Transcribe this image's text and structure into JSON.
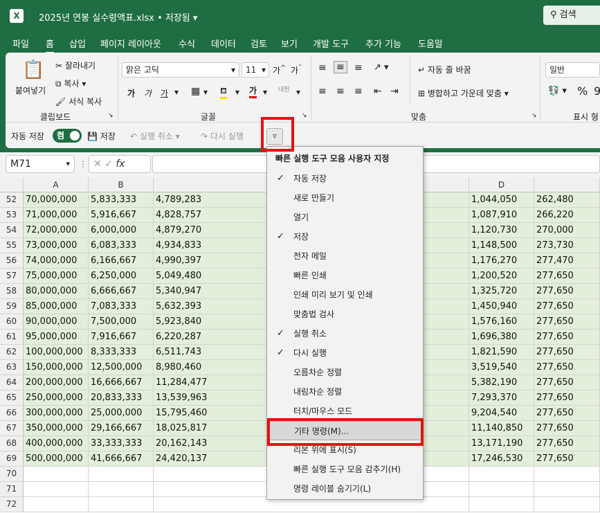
{
  "title_bar": {
    "app_icon": "X",
    "doc_title": "2025년 연봉 실수령액표.xlsx • 저장됨",
    "search": "검색"
  },
  "menu": [
    "파일",
    "홈",
    "삽입",
    "페이지 레이아웃",
    "수식",
    "데이터",
    "검토",
    "보기",
    "개발 도구",
    "추가 기능",
    "도움말"
  ],
  "ribbon": {
    "clipboard": {
      "paste": "붙여넣기",
      "cut": "잘라내기",
      "copy": "복사",
      "format_painter": "서식 복사",
      "group": "클립보드"
    },
    "font": {
      "name": "맑은 고딕",
      "size": "11",
      "bold": "가",
      "italic": "가",
      "underline": "가",
      "group": "글꼴"
    },
    "align": {
      "wrap": "자동 줄 바꿈",
      "merge": "병합하고 가운데 맞춤",
      "group": "맞춤"
    },
    "number": {
      "format": "일반",
      "group": "표시 형"
    }
  },
  "qat": {
    "autosave": "자동 저장",
    "toggle": "켬",
    "save": "저장",
    "undo": "실행 취소",
    "redo": "다시 실행"
  },
  "formula_bar": {
    "name_box": "M71",
    "fx": "fx"
  },
  "columns": [
    "A",
    "B",
    "",
    "D",
    ""
  ],
  "rows": [
    {
      "n": "52",
      "a": "70,000,000",
      "b": "5,833,333",
      "c": "4,789,283",
      "d": "1,044,050",
      "e": "262,480"
    },
    {
      "n": "53",
      "a": "71,000,000",
      "b": "5,916,667",
      "c": "4,828,757",
      "d": "1,087,910",
      "e": "266,220"
    },
    {
      "n": "54",
      "a": "72,000,000",
      "b": "6,000,000",
      "c": "4,879,270",
      "d": "1,120,730",
      "e": "270,000"
    },
    {
      "n": "55",
      "a": "73,000,000",
      "b": "6,083,333",
      "c": "4,934,833",
      "d": "1,148,500",
      "e": "273,730"
    },
    {
      "n": "56",
      "a": "74,000,000",
      "b": "6,166,667",
      "c": "4,990,397",
      "d": "1,176,270",
      "e": "277,470"
    },
    {
      "n": "57",
      "a": "75,000,000",
      "b": "6,250,000",
      "c": "5,049,480",
      "d": "1,200,520",
      "e": "277,650"
    },
    {
      "n": "58",
      "a": "80,000,000",
      "b": "6,666,667",
      "c": "5,340,947",
      "d": "1,325,720",
      "e": "277,650"
    },
    {
      "n": "59",
      "a": "85,000,000",
      "b": "7,083,333",
      "c": "5,632,393",
      "d": "1,450,940",
      "e": "277,650"
    },
    {
      "n": "60",
      "a": "90,000,000",
      "b": "7,500,000",
      "c": "5,923,840",
      "d": "1,576,160",
      "e": "277,650"
    },
    {
      "n": "61",
      "a": "95,000,000",
      "b": "7,916,667",
      "c": "6,220,287",
      "d": "1,696,380",
      "e": "277,650"
    },
    {
      "n": "62",
      "a": "100,000,000",
      "b": "8,333,333",
      "c": "6,511,743",
      "d": "1,821,590",
      "e": "277,650"
    },
    {
      "n": "63",
      "a": "150,000,000",
      "b": "12,500,000",
      "c": "8,980,460",
      "d": "3,519,540",
      "e": "277,650"
    },
    {
      "n": "64",
      "a": "200,000,000",
      "b": "16,666,667",
      "c": "11,284,477",
      "d": "5,382,190",
      "e": "277,650"
    },
    {
      "n": "65",
      "a": "250,000,000",
      "b": "20,833,333",
      "c": "13,539,963",
      "d": "7,293,370",
      "e": "277,650"
    },
    {
      "n": "66",
      "a": "300,000,000",
      "b": "25,000,000",
      "c": "15,795,460",
      "d": "9,204,540",
      "e": "277,650"
    },
    {
      "n": "67",
      "a": "350,000,000",
      "b": "29,166,667",
      "c": "18,025,817",
      "d": "11,140,850",
      "e": "277,650"
    },
    {
      "n": "68",
      "a": "400,000,000",
      "b": "33,333,333",
      "c": "20,162,143",
      "d": "13,171,190",
      "e": "277,650"
    },
    {
      "n": "69",
      "a": "500,000,000",
      "b": "41,666,667",
      "c": "24,420,137",
      "d": "17,246,530",
      "e": "277,650"
    },
    {
      "n": "70",
      "a": "",
      "b": "",
      "c": "",
      "d": "",
      "e": ""
    },
    {
      "n": "71",
      "a": "",
      "b": "",
      "c": "",
      "d": "",
      "e": ""
    },
    {
      "n": "72",
      "a": "",
      "b": "",
      "c": "",
      "d": "",
      "e": ""
    }
  ],
  "qat_menu": {
    "title": "빠른 실행 도구 모음 사용자 지정",
    "items": [
      {
        "label": "자동 저장",
        "check": "✓"
      },
      {
        "label": "새로 만들기",
        "check": ""
      },
      {
        "label": "열기",
        "check": ""
      },
      {
        "label": "저장",
        "check": "✓"
      },
      {
        "label": "전자 메일",
        "check": ""
      },
      {
        "label": "빠른 인쇄",
        "check": ""
      },
      {
        "label": "인쇄 미리 보기 및 인쇄",
        "check": ""
      },
      {
        "label": "맞춤법 검사",
        "check": ""
      },
      {
        "label": "실행 취소",
        "check": "✓"
      },
      {
        "label": "다시 실행",
        "check": "✓"
      },
      {
        "label": "오름차순 정렬",
        "check": ""
      },
      {
        "label": "내림차순 정렬",
        "check": ""
      },
      {
        "label": "터치/마우스 모드",
        "check": ""
      },
      {
        "label": "기타 명령(M)...",
        "check": ""
      },
      {
        "label": "리본 위에 표시(S)",
        "check": ""
      },
      {
        "label": "빠른 실행 도구 모음 감추기(H)",
        "check": ""
      },
      {
        "label": "명령 레이블 숨기기(L)",
        "check": ""
      }
    ]
  }
}
